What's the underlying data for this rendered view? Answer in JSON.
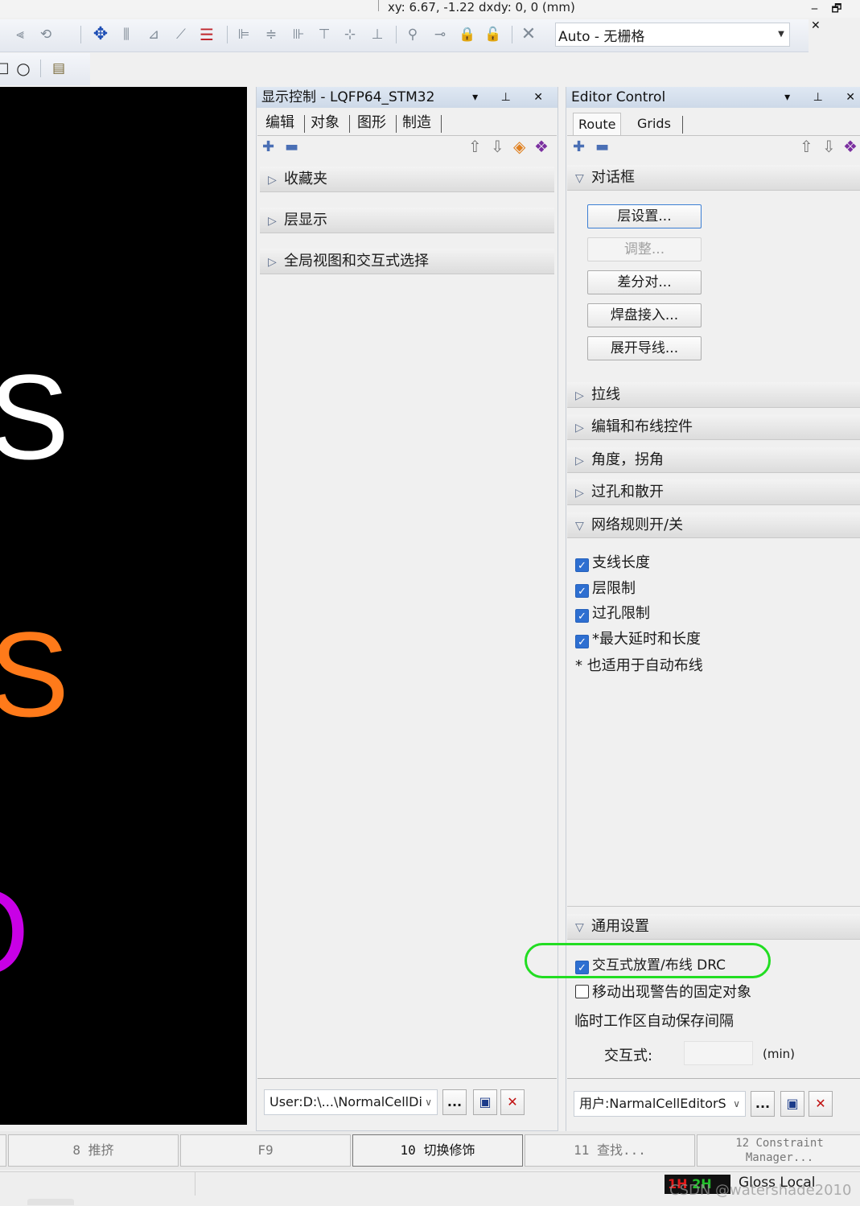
{
  "status": {
    "coord_text": "xy: 6.67, -1.22  dxdy: 0, 0  (mm)",
    "window_controls": "‒ 🗗 ✕"
  },
  "toolbar": {
    "grid_combo_value": "Auto - 无栅格"
  },
  "display_control": {
    "title": "显示控制 - LQFP64_STM32",
    "tabs": [
      "编辑",
      "对象",
      "图形",
      "制造"
    ],
    "sections": [
      "收藏夹",
      "层显示",
      "全局视图和交互式选择"
    ],
    "footer_path": "User:D:\\...\\NormalCellDi",
    "footer_more": "..."
  },
  "editor_control": {
    "title": "Editor Control",
    "tabs": [
      "Route",
      "Grids"
    ],
    "dialog_section": "对话框",
    "buttons": [
      "层设置...",
      "调整...",
      "差分对...",
      "焊盘接入...",
      "展开导线..."
    ],
    "collapsed_sections": [
      "拉线",
      "编辑和布线控件",
      "角度，拐角",
      "过孔和散开"
    ],
    "net_rules_section": "网络规则开/关",
    "net_rules": [
      {
        "label": "支线长度",
        "checked": true
      },
      {
        "label": "层限制",
        "checked": true
      },
      {
        "label": "过孔限制",
        "checked": true
      },
      {
        "label": "*最大延时和长度",
        "checked": true
      }
    ],
    "net_rules_note": "* 也适用于自动布线",
    "general_section": "通用设置",
    "general_options": [
      {
        "label": "交互式放置/布线 DRC",
        "checked": true
      },
      {
        "label": "移动出现警告的固定对象",
        "checked": false
      }
    ],
    "autosave_label": "临时工作区自动保存间隔",
    "interactive_label": "交互式:",
    "interactive_value": "",
    "unit_label": "(min)",
    "footer_user": "用户:NarmalCellEditorS",
    "footer_more": "..."
  },
  "function_keys": [
    {
      "label": "8  推挤",
      "active": false
    },
    {
      "label": "F9",
      "active": false
    },
    {
      "label": "10  切换修饰",
      "active": true
    },
    {
      "label": "11  查找...",
      "active": false
    },
    {
      "label": "12 Constraint Manager...",
      "active": false
    }
  ],
  "statusbar": {
    "layer_badge_1": "1H",
    "layer_badge_2": "2H",
    "gloss_label": "Gloss Local"
  },
  "watermark": "CSDN @watershade2010",
  "canvas_letters": [
    {
      "text": "S",
      "color": "#ffffff"
    },
    {
      "text": "S",
      "color": "#ff7a1a"
    },
    {
      "text": "O",
      "color": "#c800e6"
    }
  ],
  "colors": {
    "highlight_ring": "#22dd22",
    "checkbox_blue": "#2e6fd1"
  }
}
